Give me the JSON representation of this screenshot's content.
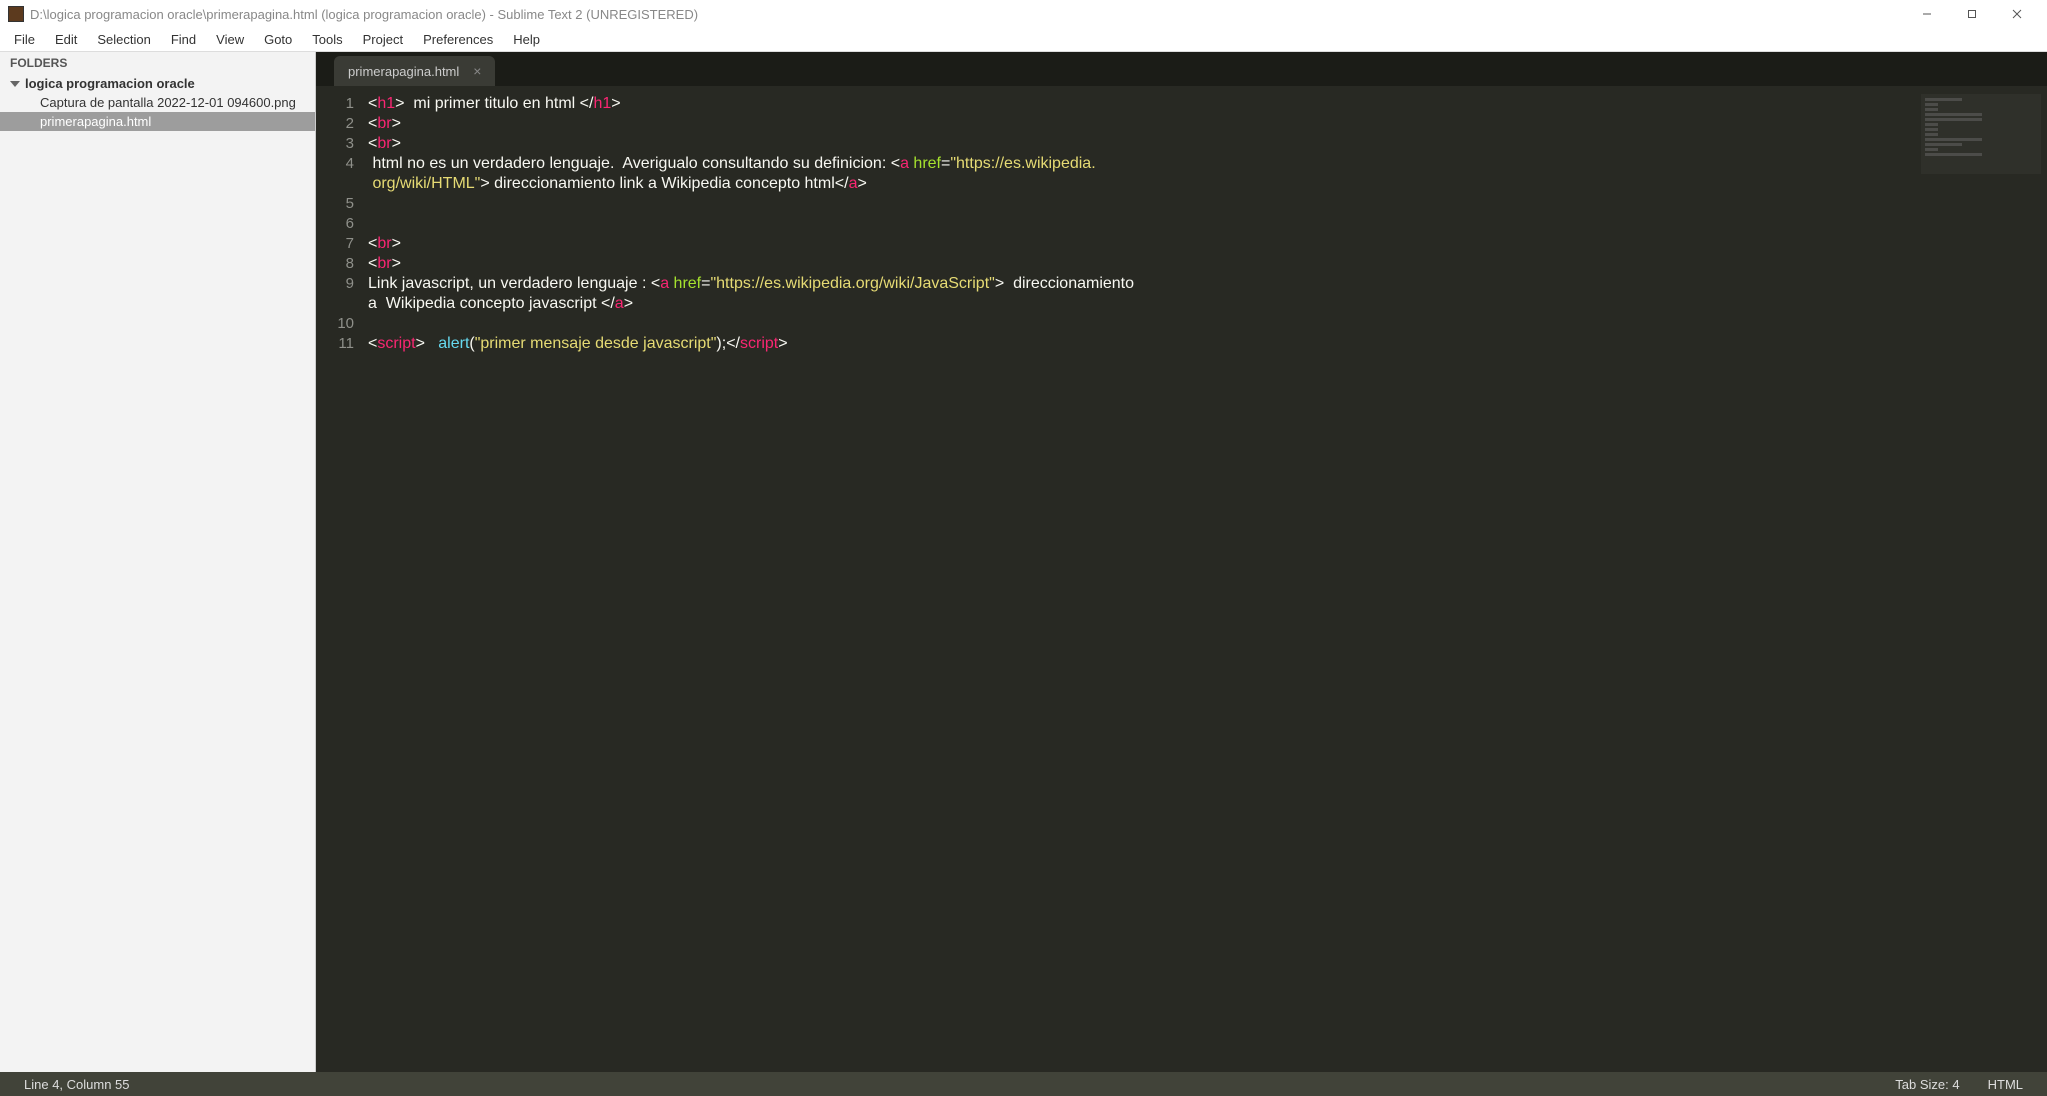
{
  "window": {
    "title": "D:\\logica programacion oracle\\primerapagina.html (logica programacion oracle) - Sublime Text 2 (UNREGISTERED)"
  },
  "menu": {
    "items": [
      "File",
      "Edit",
      "Selection",
      "Find",
      "View",
      "Goto",
      "Tools",
      "Project",
      "Preferences",
      "Help"
    ]
  },
  "sidebar": {
    "header": "FOLDERS",
    "folder": "logica programacion oracle",
    "files": [
      {
        "name": "Captura de pantalla 2022-12-01 094600.png",
        "selected": false
      },
      {
        "name": "primerapagina.html",
        "selected": true
      }
    ]
  },
  "tabs": [
    {
      "label": "primerapagina.html",
      "active": true
    }
  ],
  "code": {
    "lines": [
      [
        {
          "t": "tag-bracket",
          "v": "<"
        },
        {
          "t": "tag-name",
          "v": "h1"
        },
        {
          "t": "tag-bracket",
          "v": ">"
        },
        {
          "t": "plain",
          "v": "  mi primer titulo en html "
        },
        {
          "t": "tag-bracket",
          "v": "</"
        },
        {
          "t": "tag-name",
          "v": "h1"
        },
        {
          "t": "tag-bracket",
          "v": ">"
        }
      ],
      [
        {
          "t": "tag-bracket",
          "v": "<"
        },
        {
          "t": "tag-name",
          "v": "br"
        },
        {
          "t": "tag-bracket",
          "v": ">"
        }
      ],
      [
        {
          "t": "tag-bracket",
          "v": "<"
        },
        {
          "t": "tag-name",
          "v": "br"
        },
        {
          "t": "tag-bracket",
          "v": ">"
        }
      ],
      [
        {
          "t": "plain",
          "v": " html no es un verdadero lenguaje.  Averigualo consultando su definicion: "
        },
        {
          "t": "tag-bracket",
          "v": "<"
        },
        {
          "t": "tag-name",
          "v": "a"
        },
        {
          "t": "plain",
          "v": " "
        },
        {
          "t": "attr-name",
          "v": "href"
        },
        {
          "t": "plain",
          "v": "="
        },
        {
          "t": "attr-val",
          "v": "\"https://es.wikipedia."
        }
      ],
      [
        {
          "t": "attr-val",
          "v": " org/wiki/HTML\""
        },
        {
          "t": "tag-bracket",
          "v": ">"
        },
        {
          "t": "plain",
          "v": " direccionamiento link a Wikipedia concepto html"
        },
        {
          "t": "tag-bracket",
          "v": "</"
        },
        {
          "t": "tag-name",
          "v": "a"
        },
        {
          "t": "tag-bracket",
          "v": ">"
        }
      ],
      [],
      [],
      [
        {
          "t": "tag-bracket",
          "v": "<"
        },
        {
          "t": "tag-name",
          "v": "br"
        },
        {
          "t": "tag-bracket",
          "v": ">"
        }
      ],
      [
        {
          "t": "tag-bracket",
          "v": "<"
        },
        {
          "t": "tag-name",
          "v": "br"
        },
        {
          "t": "tag-bracket",
          "v": ">"
        }
      ],
      [
        {
          "t": "plain",
          "v": "Link javascript, un verdadero lenguaje : "
        },
        {
          "t": "tag-bracket",
          "v": "<"
        },
        {
          "t": "tag-name",
          "v": "a"
        },
        {
          "t": "plain",
          "v": " "
        },
        {
          "t": "attr-name",
          "v": "href"
        },
        {
          "t": "plain",
          "v": "="
        },
        {
          "t": "attr-val",
          "v": "\"https://es.wikipedia.org/wiki/JavaScript\""
        },
        {
          "t": "tag-bracket",
          "v": ">"
        },
        {
          "t": "plain",
          "v": "  direccionamiento "
        }
      ],
      [
        {
          "t": "plain",
          "v": "a  Wikipedia concepto javascript "
        },
        {
          "t": "tag-bracket",
          "v": "</"
        },
        {
          "t": "tag-name",
          "v": "a"
        },
        {
          "t": "tag-bracket",
          "v": ">"
        }
      ],
      [],
      [
        {
          "t": "tag-bracket",
          "v": "<"
        },
        {
          "t": "tag-name",
          "v": "script"
        },
        {
          "t": "tag-bracket",
          "v": ">"
        },
        {
          "t": "plain",
          "v": "   "
        },
        {
          "t": "func",
          "v": "alert"
        },
        {
          "t": "plain",
          "v": "("
        },
        {
          "t": "string",
          "v": "\"primer mensaje desde javascript\""
        },
        {
          "t": "plain",
          "v": ");"
        },
        {
          "t": "tag-bracket",
          "v": "</"
        },
        {
          "t": "tag-name",
          "v": "script"
        },
        {
          "t": "tag-bracket",
          "v": ">"
        }
      ]
    ],
    "line_numbers": [
      "1",
      "2",
      "3",
      "4",
      "",
      "5",
      "6",
      "7",
      "8",
      "9",
      "",
      "10",
      "11"
    ]
  },
  "status": {
    "position": "Line 4, Column 55",
    "tab_size": "Tab Size: 4",
    "syntax": "HTML"
  }
}
